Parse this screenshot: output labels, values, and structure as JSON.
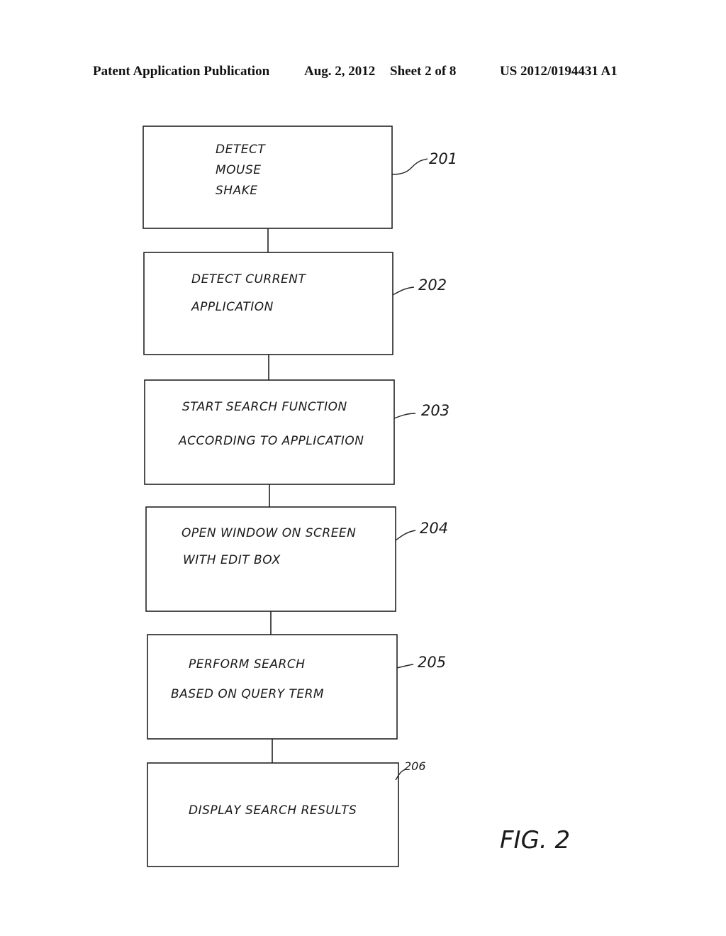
{
  "header": {
    "publication": "Patent Application Publication",
    "date": "Aug. 2, 2012",
    "sheet": "Sheet 2 of 8",
    "number": "US 2012/0194431 A1"
  },
  "steps": [
    {
      "ref": "201",
      "lines": [
        "DETECT",
        "MOUSE",
        "SHAKE"
      ]
    },
    {
      "ref": "202",
      "lines": [
        "DETECT CURRENT",
        "APPLICATION"
      ]
    },
    {
      "ref": "203",
      "lines": [
        "START SEARCH FUNCTION",
        "ACCORDING TO APPLICATION"
      ]
    },
    {
      "ref": "204",
      "lines": [
        "OPEN WINDOW ON SCREEN",
        "WITH EDIT BOX"
      ]
    },
    {
      "ref": "205",
      "lines": [
        "PERFORM SEARCH",
        "BASED ON QUERY TERM"
      ]
    },
    {
      "ref": "206",
      "lines": [
        "DISPLAY SEARCH RESULTS"
      ]
    }
  ],
  "figure_label": "FIG. 2"
}
